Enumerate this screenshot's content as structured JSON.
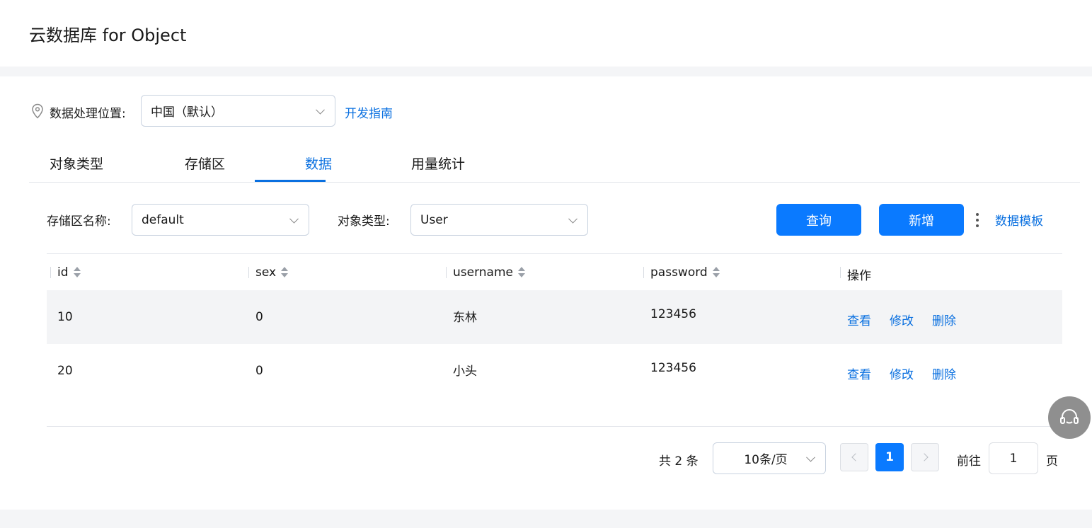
{
  "header": {
    "title": "云数据库 for Object"
  },
  "region": {
    "label": "数据处理位置:",
    "selected": "中国（默认）",
    "dev_guide": "开发指南"
  },
  "tabs": [
    {
      "label": "对象类型"
    },
    {
      "label": "存储区"
    },
    {
      "label": "数据",
      "active": true
    },
    {
      "label": "用量统计"
    }
  ],
  "filters": {
    "zone_label": "存储区名称:",
    "zone_value": "default",
    "type_label": "对象类型:",
    "type_value": "User",
    "query_button": "查询",
    "add_button": "新增",
    "template_link": "数据模板"
  },
  "table": {
    "columns": [
      "id",
      "sex",
      "username",
      "password",
      "操作"
    ],
    "rows": [
      {
        "id": "10",
        "sex": "0",
        "username": "东林",
        "password": "123456"
      },
      {
        "id": "20",
        "sex": "0",
        "username": "小头",
        "password": "123456"
      }
    ],
    "actions": {
      "view": "查看",
      "edit": "修改",
      "delete": "删除"
    }
  },
  "pagination": {
    "total": "共 2 条",
    "page_size": "10条/页",
    "current_page": "1",
    "goto_label": "前往",
    "goto_value": "1",
    "page_unit": "页"
  },
  "colors": {
    "accent": "#0a7aff",
    "link": "#0a70e0"
  }
}
